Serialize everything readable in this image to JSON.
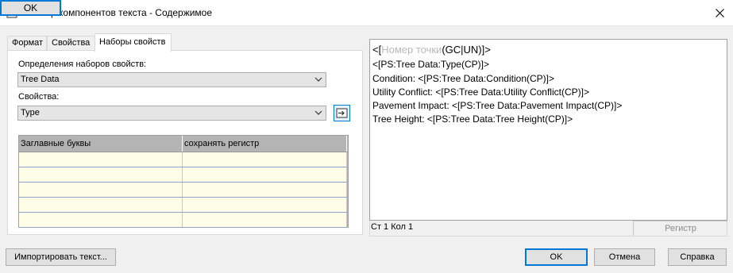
{
  "window": {
    "title": "р компонентов текста - Содержимое",
    "overlay_button": "OK"
  },
  "tabs": [
    {
      "label": "Формат",
      "active": false
    },
    {
      "label": "Свойства",
      "active": false
    },
    {
      "label": "Наборы свойств",
      "active": true
    }
  ],
  "property_sets": {
    "definitions_label": "Определения наборов свойств:",
    "definitions_value": "Tree Data",
    "properties_label": "Свойства:",
    "properties_value": "Type"
  },
  "format_grid": {
    "columns": [
      "Заглавные буквы",
      "сохранять регистр"
    ],
    "empty_rows": 5
  },
  "editor": {
    "first_line": {
      "open": "<[",
      "placeholder": "Номер точки",
      "code": "(GC|UN)]>"
    },
    "lines": [
      "<[PS:Tree Data:Type(CP)]>",
      "Condition: <[PS:Tree Data:Condition(CP)]>",
      "Utility Conflict: <[PS:Tree Data:Utility Conflict(CP)]>",
      "Pavement Impact: <[PS:Tree Data:Pavement Impact(CP)]>",
      "Tree Height: <[PS:Tree Data:Tree Height(CP)]>"
    ]
  },
  "status": {
    "position": "Ст 1 Кол 1",
    "case_label": "Регистр"
  },
  "buttons": {
    "import": "Импортировать текст...",
    "ok": "OK",
    "cancel": "Отмена",
    "help": "Справка"
  },
  "colors": {
    "accent": "#0078d7",
    "grid_header": "#b4b4b4",
    "grid_cell": "#fefde8"
  }
}
